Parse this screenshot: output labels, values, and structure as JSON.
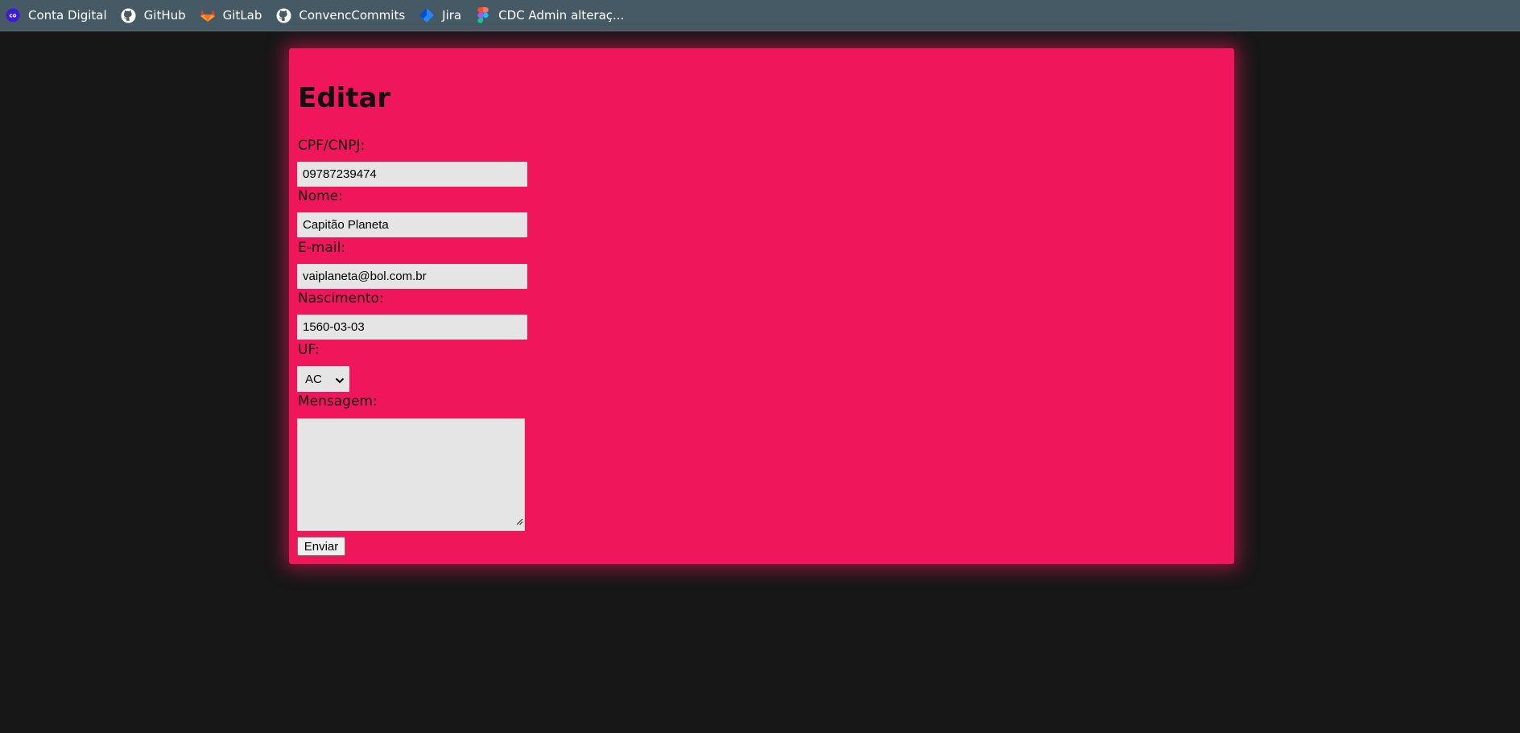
{
  "bookmarks": [
    {
      "label": "Conta Digital",
      "icon": "conta-digital-logo-icon"
    },
    {
      "label": "GitHub",
      "icon": "github-icon"
    },
    {
      "label": "GitLab",
      "icon": "gitlab-icon"
    },
    {
      "label": "ConvencCommits",
      "icon": "github-icon"
    },
    {
      "label": "Jira",
      "icon": "jira-icon"
    },
    {
      "label": "CDC Admin alteraç...",
      "icon": "figma-icon"
    }
  ],
  "form": {
    "title": "Editar",
    "fields": {
      "cpf_cnpj": {
        "label": "CPF/CNPJ:",
        "value": "09787239474"
      },
      "nome": {
        "label": "Nome:",
        "value": "Capitão Planeta"
      },
      "email": {
        "label": "E-mail:",
        "value": "vaiplaneta@bol.com.br"
      },
      "nascimento": {
        "label": "Nascimento:",
        "value": "1560-03-03"
      },
      "uf": {
        "label": "UF:",
        "value": "AC"
      },
      "mensagem": {
        "label": "Mensagem:",
        "value": ""
      }
    },
    "submit_label": "Enviar"
  },
  "colors": {
    "background": "#171717",
    "bookmarks_bar": "#455a64",
    "card": "#ef165b",
    "input": "#e5e5e5"
  }
}
